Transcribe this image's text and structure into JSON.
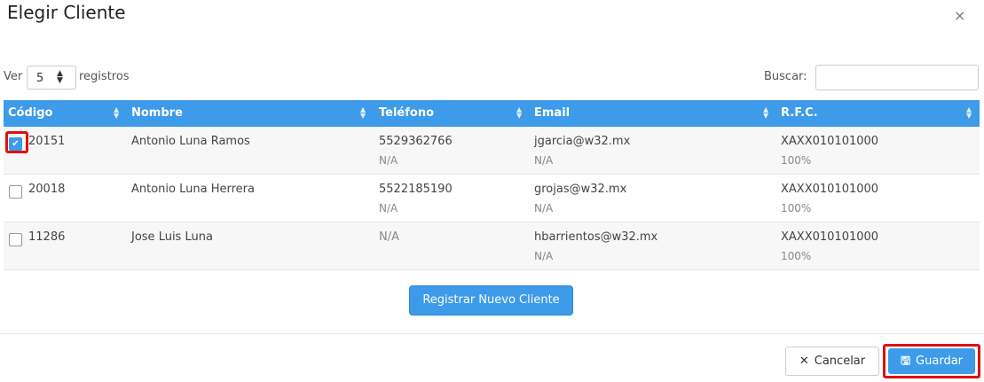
{
  "modal": {
    "title": "Elegir Cliente",
    "close_icon": "×"
  },
  "controls": {
    "ver_label": "Ver",
    "length_value": "5",
    "registros_label": "registros",
    "buscar_label": "Buscar:",
    "search_value": ""
  },
  "table": {
    "headers": [
      "Código",
      "Nombre",
      "Teléfono",
      "Email",
      "R.F.C."
    ],
    "rows": [
      {
        "checked": true,
        "codigo": "20151",
        "nombre": "Antonio Luna Ramos",
        "telefono": "5529362766",
        "telefono_sub": "N/A",
        "email": "jgarcia@w32.mx",
        "email_sub": "N/A",
        "rfc": "XAXX010101000",
        "rfc_sub": "100%"
      },
      {
        "checked": false,
        "codigo": "20018",
        "nombre": "Antonio Luna Herrera",
        "telefono": "5522185190",
        "telefono_sub": "N/A",
        "email": "grojas@w32.mx",
        "email_sub": "N/A",
        "rfc": "XAXX010101000",
        "rfc_sub": "100%"
      },
      {
        "checked": false,
        "codigo": "11286",
        "nombre": "Jose Luis Luna",
        "telefono": "N/A",
        "telefono_sub": "",
        "email": "hbarrientos@w32.mx",
        "email_sub": "N/A",
        "rfc": "XAXX010101000",
        "rfc_sub": "100%"
      }
    ]
  },
  "buttons": {
    "register": "Registrar Nuevo Cliente",
    "cancel": "Cancelar",
    "save": "Guardar"
  },
  "colors": {
    "accent": "#3d9be9",
    "highlight": "#e01010"
  }
}
